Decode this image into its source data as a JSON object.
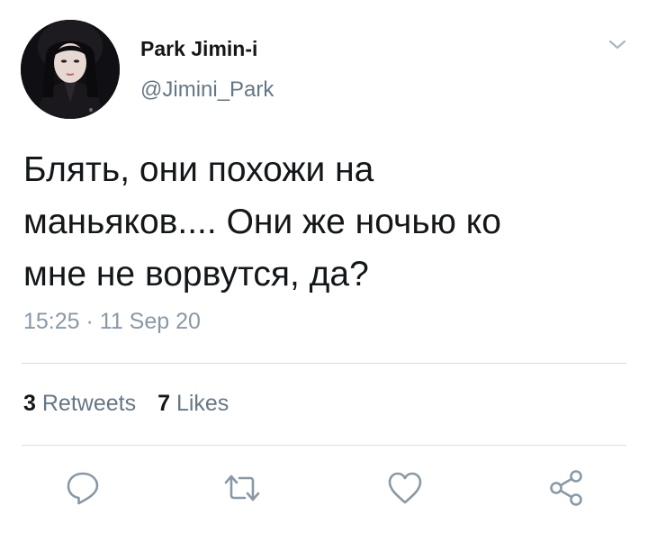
{
  "user": {
    "display_name": "Park Jimin-i",
    "handle": "@Jimini_Park",
    "avatar_icon": "profile-photo"
  },
  "tweet": {
    "text_lines": [
      "Блять, они похожи на",
      "маньяков.... Они же ночью ко",
      "мне не ворвутся, да?"
    ],
    "timestamp": "15:25 · 11 Sep 20"
  },
  "stats": {
    "retweets_count": "3",
    "retweets_label": "Retweets",
    "likes_count": "7",
    "likes_label": "Likes"
  },
  "actions": [
    {
      "icon": "reply-icon"
    },
    {
      "icon": "retweet-icon"
    },
    {
      "icon": "like-icon"
    },
    {
      "icon": "share-icon"
    }
  ],
  "colors": {
    "text": "#14171a",
    "secondary": "#657786",
    "timestamp": "#8899a6",
    "icon": "#8899a6",
    "divider": "#d8dfe4"
  }
}
